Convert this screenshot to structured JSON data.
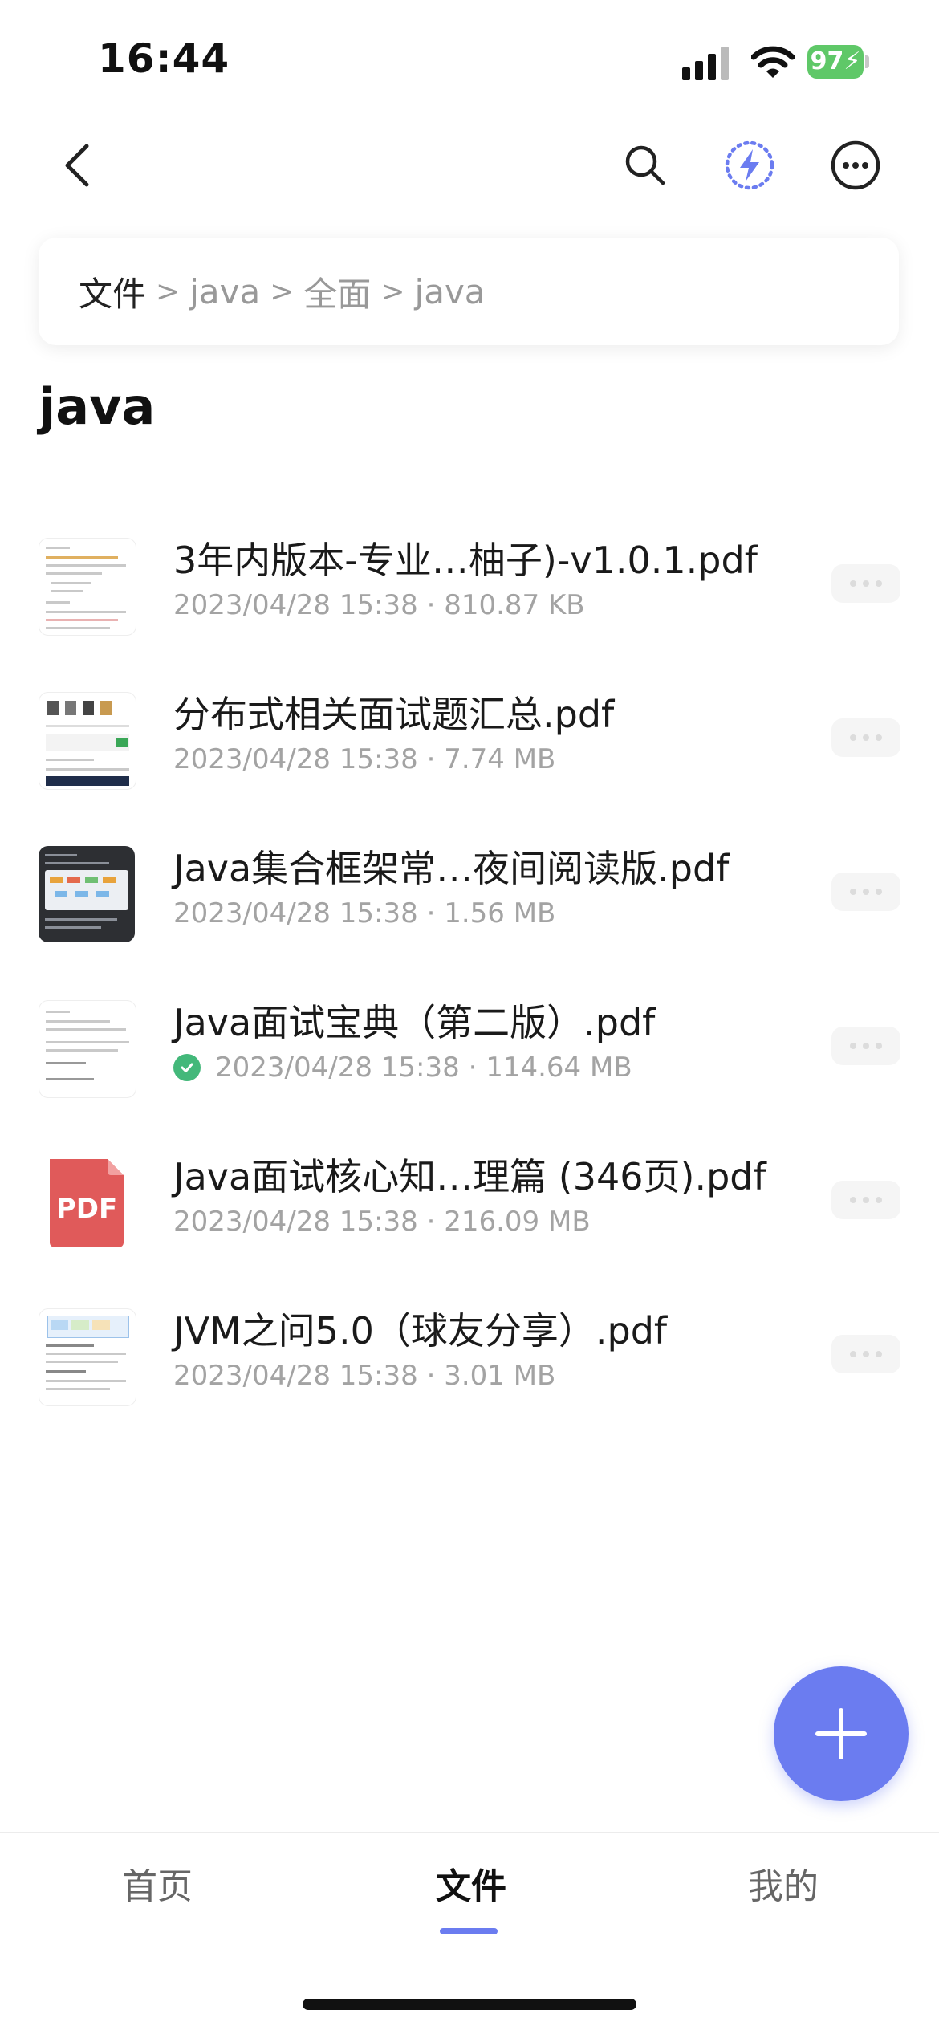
{
  "status_bar": {
    "time": "16:44",
    "battery": "97"
  },
  "nav": {
    "back_icon": "chevron-left-icon",
    "search_icon": "search-icon",
    "flash_icon": "lightning-icon",
    "more_icon": "ellipsis-circle-icon"
  },
  "breadcrumb": {
    "root": "文件",
    "items": [
      "java",
      "全面",
      "java"
    ]
  },
  "folder": {
    "title": "java"
  },
  "files": [
    {
      "name": "3年内版本-专业…柚子)-v1.0.1.pdf",
      "date": "2023/04/28 15:38",
      "size": "810.87 KB",
      "synced": false
    },
    {
      "name": "分布式相关面试题汇总.pdf",
      "date": "2023/04/28 15:38",
      "size": "7.74 MB",
      "synced": false
    },
    {
      "name": "Java集合框架常…夜间阅读版.pdf",
      "date": "2023/04/28 15:38",
      "size": "1.56 MB",
      "synced": false
    },
    {
      "name": "Java面试宝典（第二版）.pdf",
      "date": "2023/04/28 15:38",
      "size": "114.64 MB",
      "synced": true
    },
    {
      "name": "Java面试核心知…理篇 (346页).pdf",
      "date": "2023/04/28 15:38",
      "size": "216.09 MB",
      "synced": false,
      "icon_label": "PDF"
    },
    {
      "name": "JVM之问5.0（球友分享）.pdf",
      "date": "2023/04/28 15:38",
      "size": "3.01 MB",
      "synced": false
    }
  ],
  "meta_separator": "·",
  "tabbar": {
    "home": "首页",
    "files": "文件",
    "mine": "我的",
    "active": "files"
  },
  "colors": {
    "accent": "#6b7cf0",
    "battery": "#5fc868",
    "synced": "#43b87a"
  }
}
